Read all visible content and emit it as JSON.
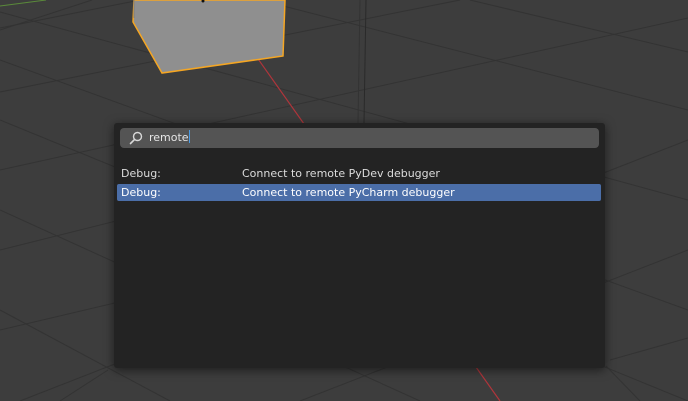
{
  "viewport": {
    "background_color": "#3d3d3d",
    "object_outline_color": "#f5a623",
    "x_axis_color": "#b0353b"
  },
  "search": {
    "value": "remote",
    "icon": "search-icon",
    "caret_color": "#4a9be4"
  },
  "results": [
    {
      "category": "Debug:",
      "label": "Connect to remote PyDev debugger",
      "selected": false
    },
    {
      "category": "Debug:",
      "label": "Connect to remote PyCharm debugger",
      "selected": true
    }
  ],
  "colors": {
    "popup_bg": "#232323",
    "field_bg": "#545454",
    "selection": "#4b6ea8"
  }
}
